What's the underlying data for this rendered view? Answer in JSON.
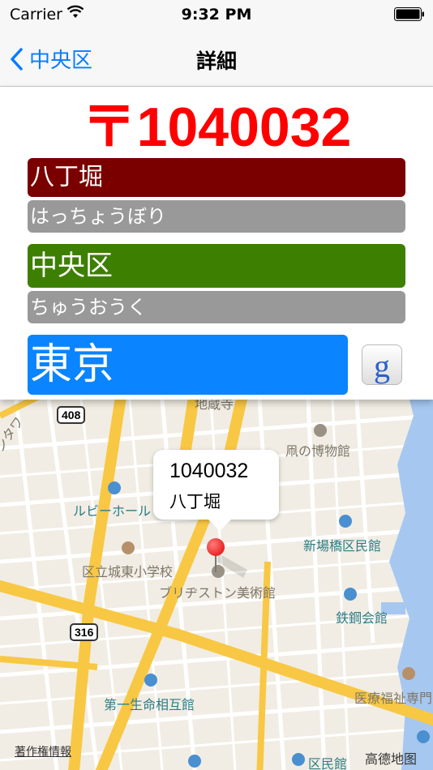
{
  "status_bar": {
    "carrier": "Carrier",
    "time": "9:32 PM"
  },
  "nav": {
    "back_label": "中央区",
    "title": "詳細"
  },
  "detail": {
    "postal_code": "〒1040032",
    "town": "八丁堀",
    "town_kana": "はっちょうぼり",
    "ward": "中央区",
    "ward_kana": "ちゅうおうく",
    "prefecture": "東京",
    "google_label": "g"
  },
  "colors": {
    "postal": "#ff0000",
    "town_bar": "#7a0000",
    "ward_bar": "#3d7f00",
    "prefecture_bar": "#0a84ff",
    "kana_bar": "#999999",
    "link_blue": "#0a7cff"
  },
  "map": {
    "callout_title": "1040032",
    "callout_subtitle": "八丁堀",
    "labels": {
      "top_partial": "地蔵寺",
      "museum": "凧の博物館",
      "ruby_hall": "ルビーホール",
      "shinbashi": "新場橋区民館",
      "school": "区立城東小学校",
      "bridgestone": "ブリヂストン美術館",
      "tekko": "鉄鋼会館",
      "daiichi": "第一生命相互館",
      "iryo": "医療福祉専門",
      "kuminkan": "区民館",
      "left_edge": "ンタワ"
    },
    "road_shields": [
      "408",
      "316"
    ],
    "copyright": "著作権情報",
    "provider": "高德地图"
  }
}
